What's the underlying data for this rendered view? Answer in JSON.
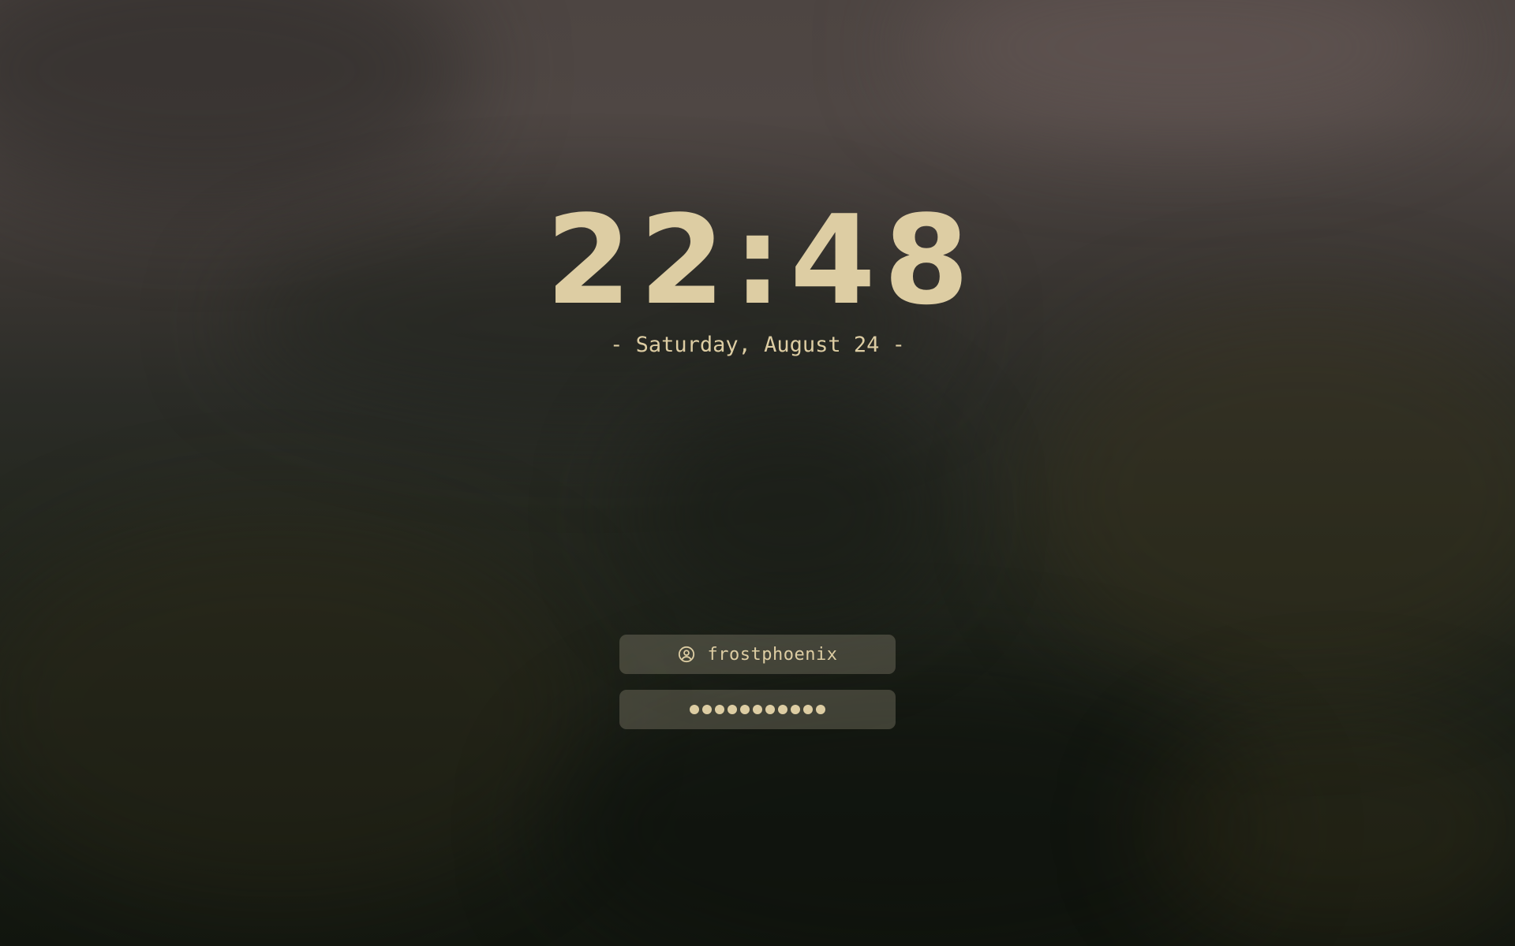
{
  "lockscreen": {
    "time": "22:48",
    "date": "- Saturday, August 24 -",
    "username": "frostphoenix",
    "user_icon": "user-circle-icon",
    "password_mask_count": 11
  },
  "colors": {
    "text": "#ddcda3",
    "field_background": "#948e7a"
  }
}
